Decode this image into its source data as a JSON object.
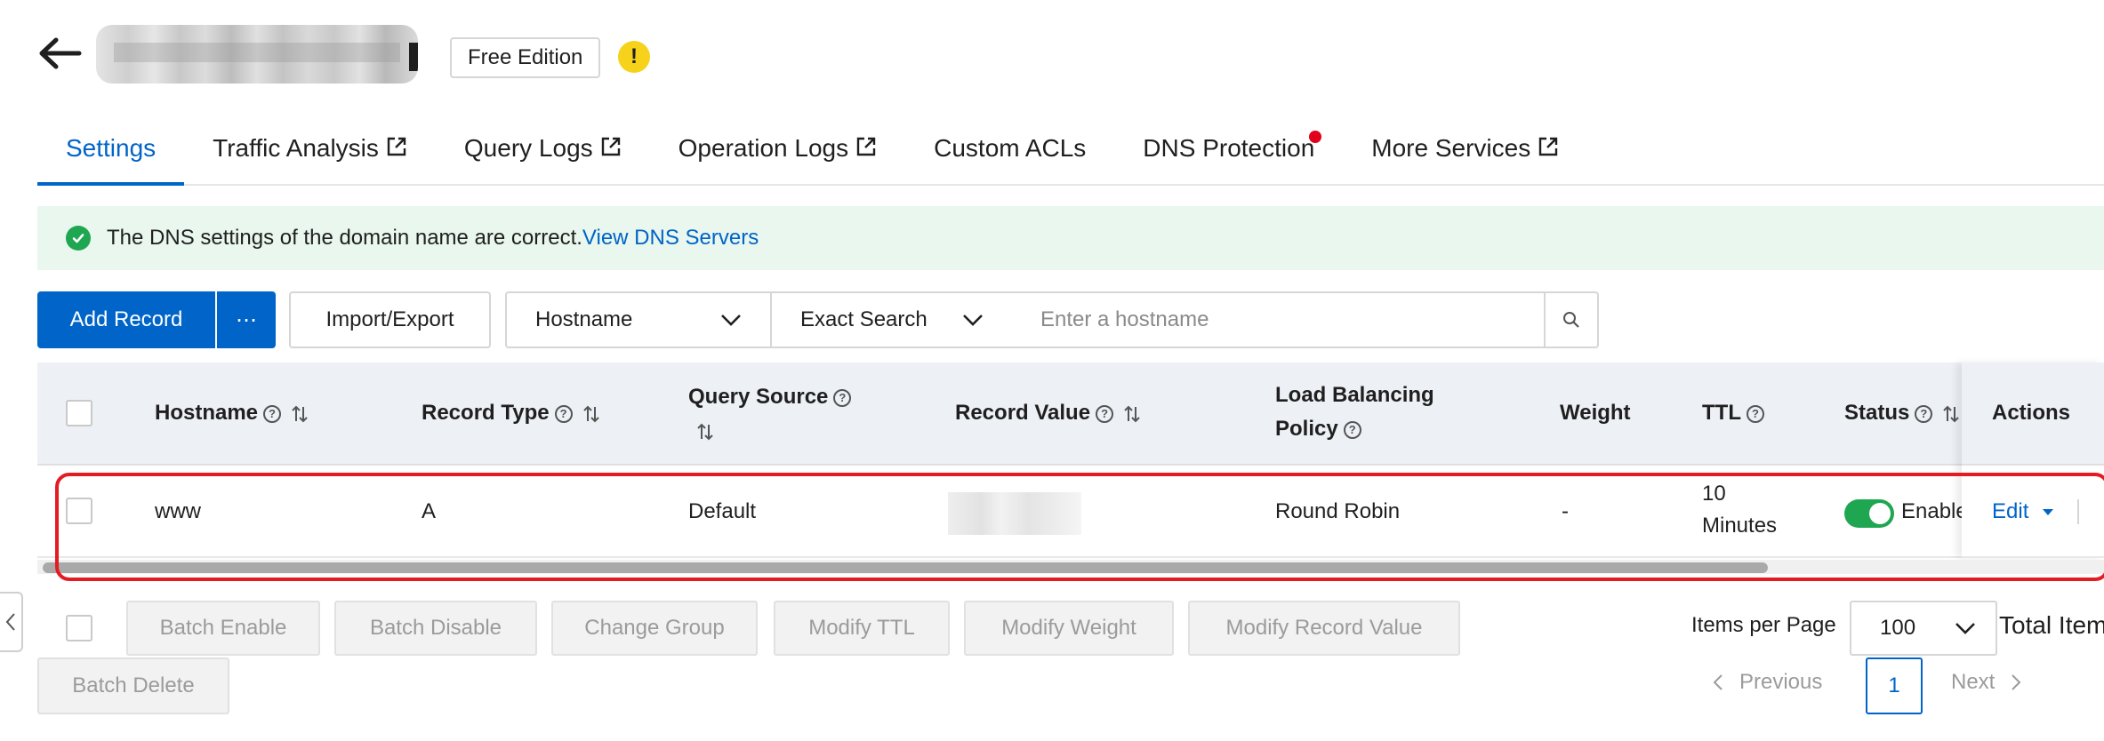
{
  "header": {
    "edition_badge": "Free Edition",
    "warning_glyph": "!"
  },
  "tabs": [
    {
      "label": "Settings"
    },
    {
      "label": "Traffic Analysis"
    },
    {
      "label": "Query Logs"
    },
    {
      "label": "Operation Logs"
    },
    {
      "label": "Custom ACLs"
    },
    {
      "label": "DNS Protection"
    },
    {
      "label": "More Services"
    }
  ],
  "alert": {
    "text": "The DNS settings of the domain name are correct.",
    "link": "View DNS Servers"
  },
  "toolbar": {
    "add_record": "Add Record",
    "more": "⋯",
    "import_export": "Import/Export",
    "field_select": "Hostname",
    "match_select": "Exact Search",
    "search_placeholder": "Enter a hostname"
  },
  "table": {
    "columns": {
      "hostname": "Hostname",
      "record_type": "Record Type",
      "query_source": "Query Source",
      "record_value": "Record Value",
      "lb_policy_line1": "Load Balancing",
      "lb_policy_line2": "Policy",
      "weight": "Weight",
      "ttl": "TTL",
      "status": "Status",
      "actions": "Actions"
    },
    "rows": [
      {
        "hostname": "www",
        "record_type": "A",
        "query_source": "Default",
        "lb_policy": "Round Robin",
        "weight": "-",
        "ttl_line1": "10",
        "ttl_line2": "Minutes",
        "status": "Enable",
        "status_enabled": true,
        "edit": "Edit"
      }
    ]
  },
  "batch_actions": {
    "enable": "Batch Enable",
    "disable": "Batch Disable",
    "change_group": "Change Group",
    "modify_ttl": "Modify TTL",
    "modify_weight": "Modify Weight",
    "modify_value": "Modify Record Value",
    "delete": "Batch Delete"
  },
  "pagination": {
    "items_per_page_label": "Items per Page",
    "items_per_page": "100",
    "total_label": "Total Item",
    "previous": "Previous",
    "current_page": "1",
    "next": "Next"
  },
  "colors": {
    "primary": "#0064c8",
    "success": "#1fa651",
    "alert_bg": "#e9f7ee",
    "highlight": "#e31c23",
    "warning": "#f7d21b"
  }
}
